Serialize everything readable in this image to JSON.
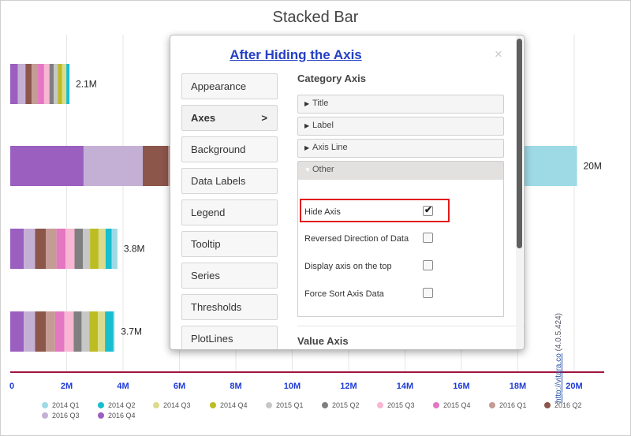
{
  "chart_title": "Stacked Bar",
  "watermark": {
    "link": "http://vitara.co",
    "version": "(4.0.5.424)"
  },
  "chart_data": {
    "type": "bar",
    "orientation": "horizontal",
    "stacked": true,
    "title": "Stacked Bar",
    "xlim": [
      0,
      21000000
    ],
    "x_ticks": [
      "0",
      "2M",
      "4M",
      "6M",
      "8M",
      "10M",
      "12M",
      "14M",
      "16M",
      "18M",
      "20M"
    ],
    "tick_values": [
      0,
      2000000,
      4000000,
      6000000,
      8000000,
      10000000,
      12000000,
      14000000,
      16000000,
      18000000,
      20000000
    ],
    "axis_line_color": "#a0153e",
    "grid": true,
    "legend_position": "bottom",
    "bars": [
      {
        "total_label": "2.1M",
        "total": 2100000,
        "visible": true
      },
      {
        "total_label": "20M",
        "total": 20100000,
        "visible": true
      },
      {
        "total_label": "3.8M",
        "total": 3800000,
        "visible": true
      },
      {
        "total_label": "3.7M",
        "total": 3700000,
        "visible": true
      }
    ],
    "series": [
      {
        "name": "2016 Q4",
        "color": "#9b5fc0",
        "values": [
          270000,
          2600000,
          480000,
          480000
        ]
      },
      {
        "name": "2016 Q3",
        "color": "#c5b0d5",
        "values": [
          270000,
          2100000,
          400000,
          400000
        ]
      },
      {
        "name": "2016 Q2",
        "color": "#8c564b",
        "values": [
          220000,
          900000,
          380000,
          380000
        ]
      },
      {
        "name": "2016 Q1",
        "color": "#c49c94",
        "values": [
          220000,
          1600000,
          380000,
          330000
        ]
      },
      {
        "name": "2015 Q4",
        "color": "#e377c2",
        "values": [
          220000,
          1700000,
          320000,
          330000
        ]
      },
      {
        "name": "2015 Q3",
        "color": "#f7b6d2",
        "values": [
          190000,
          1500000,
          320000,
          330000
        ]
      },
      {
        "name": "2015 Q2",
        "color": "#7f7f7f",
        "values": [
          150000,
          1400000,
          300000,
          280000
        ]
      },
      {
        "name": "2015 Q1",
        "color": "#c7c7c7",
        "values": [
          150000,
          1500000,
          250000,
          280000
        ]
      },
      {
        "name": "2014 Q4",
        "color": "#bcbd22",
        "values": [
          150000,
          1500000,
          300000,
          300000
        ]
      },
      {
        "name": "2014 Q3",
        "color": "#dbdb8d",
        "values": [
          150000,
          1600000,
          250000,
          250000
        ]
      },
      {
        "name": "2014 Q2",
        "color": "#17becf",
        "values": [
          110000,
          1350000,
          220000,
          300000
        ]
      },
      {
        "name": "2014 Q1",
        "color": "#9edae5",
        "values": [
          100000,
          900000,
          200000,
          120000
        ]
      }
    ],
    "legend_order": [
      "2014 Q1",
      "2014 Q2",
      "2014 Q3",
      "2014 Q4",
      "2015 Q1",
      "2015 Q2",
      "2015 Q3",
      "2015 Q4",
      "2016 Q1",
      "2016 Q2",
      "2016 Q3",
      "2016 Q4"
    ]
  },
  "dialog": {
    "title": "After Hiding the Axis",
    "close_icon": "×",
    "nav": [
      {
        "label": "Appearance",
        "active": false
      },
      {
        "label": "Axes",
        "active": true,
        "arrow": ">"
      },
      {
        "label": "Background",
        "active": false
      },
      {
        "label": "Data Labels",
        "active": false
      },
      {
        "label": "Legend",
        "active": false
      },
      {
        "label": "Tooltip",
        "active": false
      },
      {
        "label": "Series",
        "active": false
      },
      {
        "label": "Thresholds",
        "active": false
      },
      {
        "label": "PlotLines",
        "active": false
      }
    ],
    "panel": {
      "heading": "Category Axis",
      "sections": [
        {
          "label": "Title",
          "expanded": false
        },
        {
          "label": "Label",
          "expanded": false
        },
        {
          "label": "Axis Line",
          "expanded": false
        },
        {
          "label": "Other",
          "expanded": true
        }
      ],
      "options": [
        {
          "label": "Hide Axis",
          "checked": true,
          "highlighted": true
        },
        {
          "label": "Reversed Direction of Data",
          "checked": false
        },
        {
          "label": "Display axis on the top",
          "checked": false
        },
        {
          "label": "Force Sort Axis Data",
          "checked": false
        }
      ],
      "next_heading": "Value Axis"
    }
  }
}
